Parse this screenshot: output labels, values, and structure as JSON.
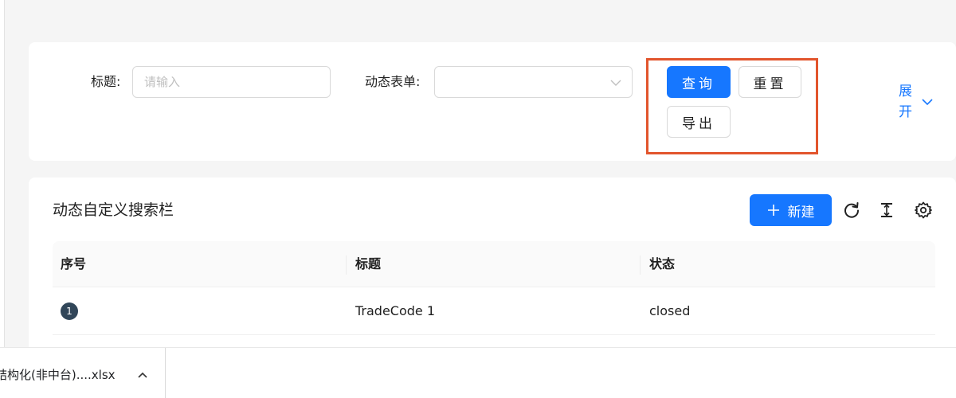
{
  "search": {
    "title_label": "标题:",
    "title_placeholder": "请输入",
    "title_value": "",
    "form_label": "动态表单:",
    "form_selected": "",
    "query_button": "查询",
    "reset_button": "重置",
    "export_button": "导出",
    "expand_label": "展开"
  },
  "table": {
    "title": "动态自定义搜索栏",
    "new_button": "新建",
    "columns": [
      "序号",
      "标题",
      "状态"
    ],
    "rows": [
      {
        "index": "1",
        "title": "TradeCode 1",
        "status": "closed"
      }
    ]
  },
  "download_bar": {
    "file_name": "结构化(非中台)....xlsx"
  },
  "icons": {
    "select_arrow": "chevron-down-icon",
    "expand": "chevron-down-icon",
    "new": "plus-icon",
    "reload": "reload-icon",
    "density": "column-height-icon",
    "settings": "gear-icon",
    "download_menu": "chevron-up-icon"
  },
  "colors": {
    "primary": "#1677ff",
    "highlight": "#e2552d",
    "background": "#f5f5f5",
    "badge": "#314659"
  }
}
